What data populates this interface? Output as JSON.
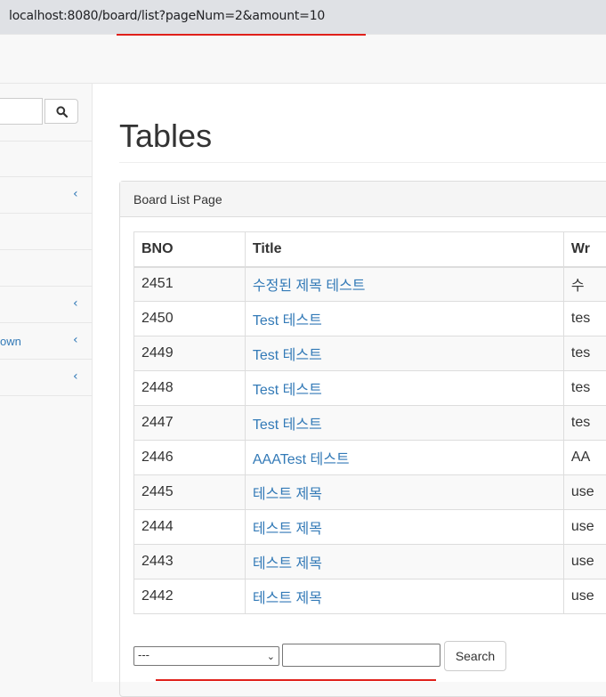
{
  "browser": {
    "url": "localhost:8080/board/list?pageNum=2&amount=10"
  },
  "sidebar": {
    "items": [
      {
        "label": "",
        "has_chevron": false
      },
      {
        "label": "",
        "has_chevron": true
      },
      {
        "label": "",
        "has_chevron": false
      },
      {
        "label": "",
        "has_chevron": false
      },
      {
        "label": "",
        "has_chevron": true
      },
      {
        "label": "own",
        "has_chevron": true
      },
      {
        "label": "",
        "has_chevron": true
      }
    ],
    "chevron_glyph": "‹"
  },
  "page": {
    "title": "Tables",
    "panel_heading": "Board List Page"
  },
  "table": {
    "headers": [
      "BNO",
      "Title",
      "Wr"
    ],
    "rows": [
      {
        "bno": "2451",
        "title": "수정된 제목 테스트",
        "writer": "수"
      },
      {
        "bno": "2450",
        "title": "Test 테스트",
        "writer": "tes"
      },
      {
        "bno": "2449",
        "title": "Test 테스트",
        "writer": "tes"
      },
      {
        "bno": "2448",
        "title": "Test 테스트",
        "writer": "tes"
      },
      {
        "bno": "2447",
        "title": "Test 테스트",
        "writer": "tes"
      },
      {
        "bno": "2446",
        "title": "AAATest 테스트",
        "writer": "AA"
      },
      {
        "bno": "2445",
        "title": "테스트 제목",
        "writer": "use"
      },
      {
        "bno": "2444",
        "title": "테스트 제목",
        "writer": "use"
      },
      {
        "bno": "2443",
        "title": "테스트 제목",
        "writer": "use"
      },
      {
        "bno": "2442",
        "title": "테스트 제목",
        "writer": "use"
      }
    ]
  },
  "search": {
    "type_selected": "---",
    "keyword_value": "",
    "button_label": "Search"
  },
  "colors": {
    "link": "#337ab7",
    "underline_marker": "#e0201a"
  }
}
